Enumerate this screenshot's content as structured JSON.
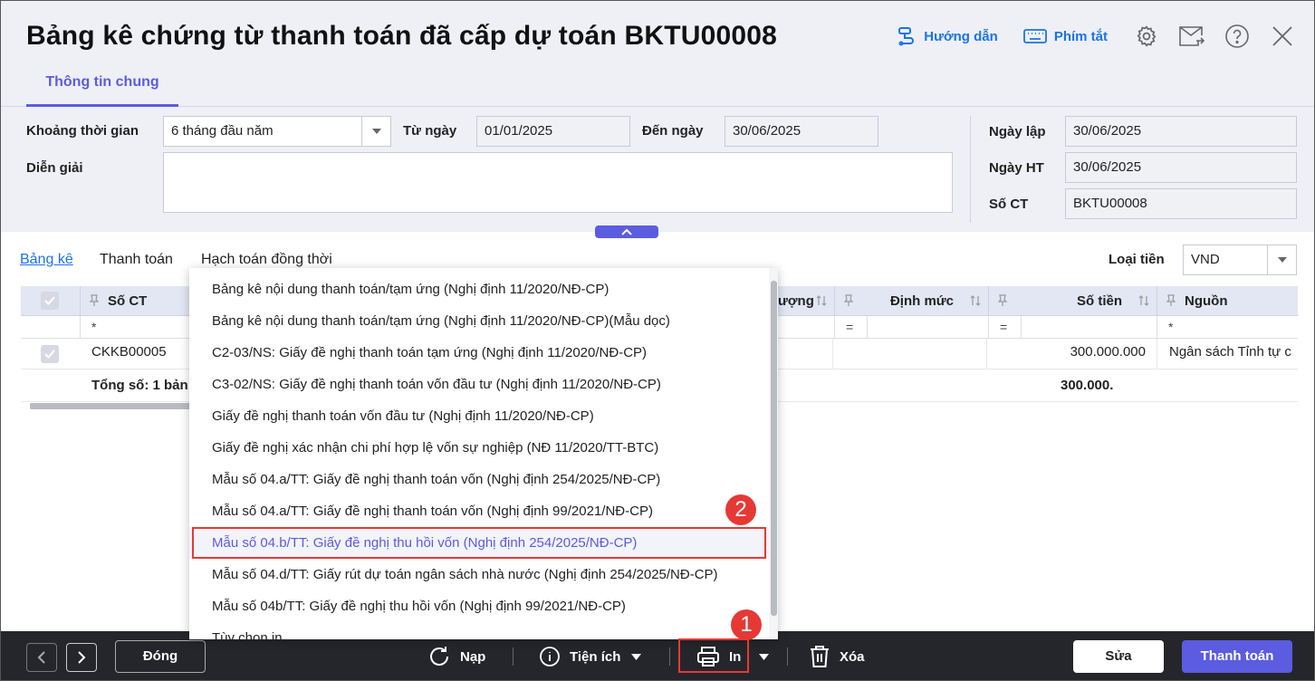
{
  "window": {
    "title": "Bảng kê chứng từ thanh toán đã cấp dự toán BKTU00008",
    "help_label": "Hướng dẫn",
    "shortcut_label": "Phím tắt"
  },
  "tabs": {
    "general": "Thông tin chung"
  },
  "form": {
    "period_label": "Khoảng thời gian",
    "period_value": "6 tháng đầu năm",
    "from_label": "Từ ngày",
    "from_value": "01/01/2025",
    "to_label": "Đến ngày",
    "to_value": "30/06/2025",
    "desc_label": "Diễn giải",
    "desc_value": "",
    "created_label": "Ngày lập",
    "created_value": "30/06/2025",
    "posted_label": "Ngày HT",
    "posted_value": "30/06/2025",
    "docno_label": "Số CT",
    "docno_value": "BKTU00008"
  },
  "subtabs": {
    "list": "Bảng kê",
    "payment": "Thanh toán",
    "accounting": "Hạch toán đồng thời"
  },
  "currency": {
    "label": "Loại tiền",
    "value": "VND"
  },
  "grid": {
    "columns": {
      "docno": "Số CT",
      "qty": "ượng",
      "norm": "Định mức",
      "amount": "Số tiền",
      "source": "Nguồn"
    },
    "filters": {
      "docno": "*",
      "norm": "=",
      "amount": "=",
      "source": "*",
      "qty": "="
    },
    "row": {
      "docno": "CKKB00005",
      "amount": "300.000.000",
      "source": "Ngân sách Tỉnh tự c"
    },
    "total": {
      "label": "Tổng số: 1 bản",
      "amount": "300.000."
    }
  },
  "menu": {
    "items": [
      "Bảng kê nội dung thanh toán/tạm ứng (Nghị định 11/2020/NĐ-CP)",
      "Bảng kê nội dung thanh toán/tạm ứng (Nghị định 11/2020/NĐ-CP)(Mẫu dọc)",
      "C2-03/NS: Giấy đề nghị thanh toán tạm ứng (Nghị định 11/2020/NĐ-CP)",
      "C3-02/NS: Giấy đề nghị thanh toán vốn đầu tư (Nghị định 11/2020/NĐ-CP)",
      "Giấy đề nghị thanh toán vốn đầu tư (Nghị định 11/2020/NĐ-CP)",
      "Giấy đề nghị xác nhận chi phí hợp lệ vốn sự nghiệp (NĐ 11/2020/TT-BTC)",
      "Mẫu số 04.a/TT: Giấy đề nghị thanh toán vốn (Nghị định 254/2025/NĐ-CP)",
      "Mẫu số 04.a/TT: Giấy đề nghị thanh toán vốn (Nghị định 99/2021/NĐ-CP)",
      "Mẫu số 04.b/TT: Giấy đề nghị thu hồi vốn (Nghị định 254/2025/NĐ-CP)",
      "Mẫu số 04.d/TT: Giấy rút dự toán ngân sách nhà nước (Nghị định 254/2025/NĐ-CP)",
      "Mẫu số 04b/TT: Giấy đề nghị thu hồi vốn (Nghị định 99/2021/NĐ-CP)",
      "Tùy chọn in"
    ],
    "highlighted_index": 8
  },
  "badges": {
    "one": "1",
    "two": "2"
  },
  "footer": {
    "close": "Đóng",
    "reload": "Nạp",
    "utilities": "Tiện ích",
    "print": "In",
    "delete": "Xóa",
    "edit": "Sửa",
    "pay": "Thanh toán"
  },
  "colors": {
    "accent": "#5b5ce0",
    "link": "#1a73e8",
    "marker": "#e53935",
    "footer": "#25262c"
  }
}
